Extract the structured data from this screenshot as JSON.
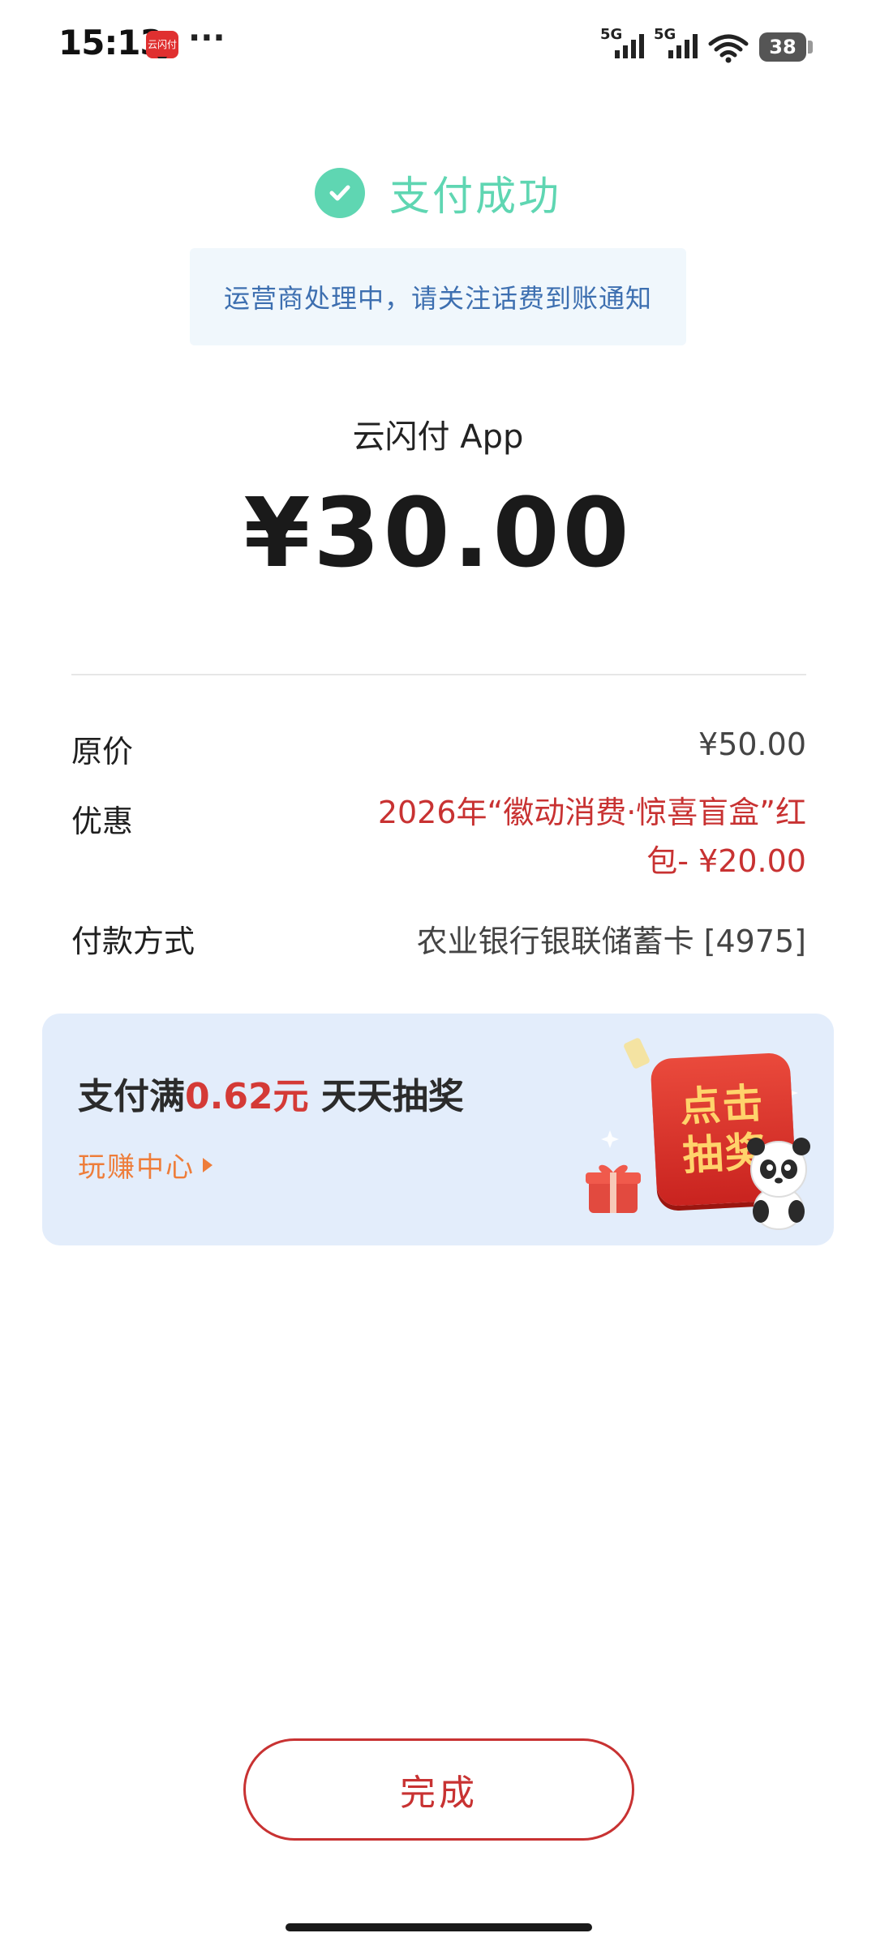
{
  "status_bar": {
    "time": "15:13",
    "app_icon_text": "云闪付",
    "more": "···",
    "signal_1_label": "5G",
    "signal_2_label": "5G",
    "battery": "38"
  },
  "result": {
    "status": "支付成功",
    "notice": "运营商处理中，请关注话费到账通知",
    "merchant": "云闪付 App",
    "amount": "¥30.00"
  },
  "details": {
    "original_price_label": "原价",
    "original_price_value": "¥50.00",
    "discount_label": "优惠",
    "discount_value": "2026年“徽动消费·惊喜盲盒”红包- ¥20.00",
    "payment_method_label": "付款方式",
    "payment_method_value": "农业银行银联储蓄卡 [4975]"
  },
  "banner": {
    "title_prefix": "支付满",
    "title_amount": "0.62元",
    "title_suffix": " 天天抽奖",
    "link": "玩赚中心",
    "box_line_1": "点击",
    "box_line_2": "抽奖"
  },
  "actions": {
    "done": "完成"
  },
  "colors": {
    "success": "#5fd6b2",
    "notice_text": "#3d6fb0",
    "accent_red": "#c83232",
    "link_orange": "#ee7d3a",
    "banner_bg": "#e3edfb"
  },
  "icons": {
    "success": "check-circle-icon",
    "link_arrow": "triangle-right-icon",
    "wifi": "wifi-icon",
    "signal": "cell-signal-icon"
  }
}
